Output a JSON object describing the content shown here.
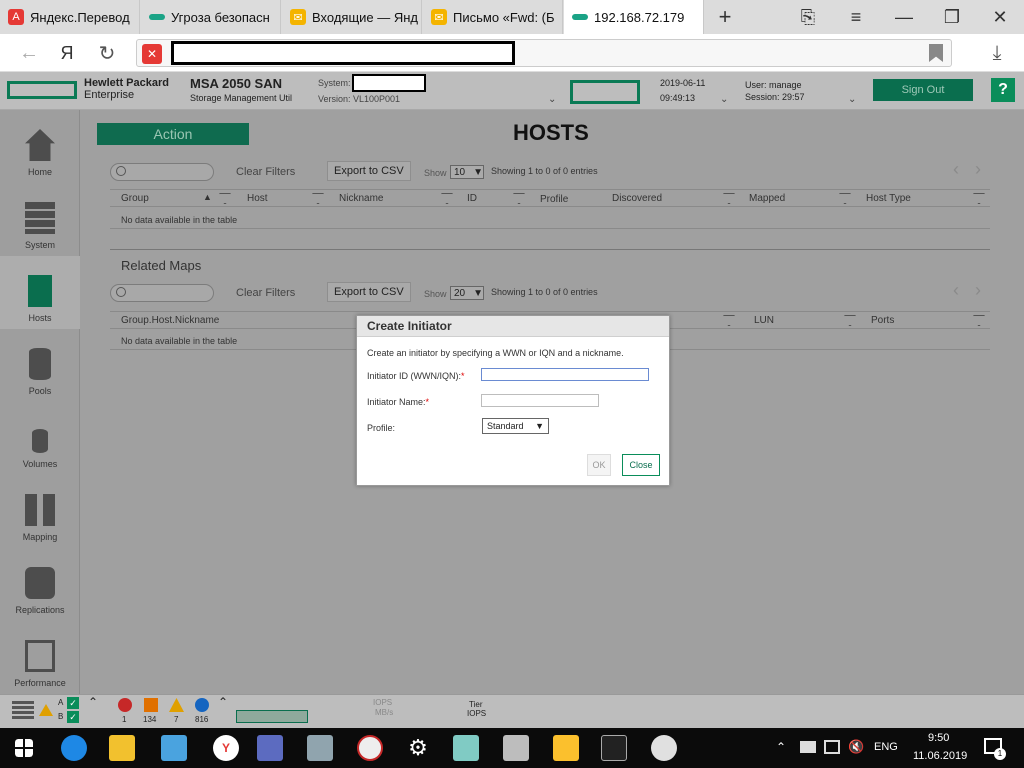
{
  "browser": {
    "tabs": [
      {
        "title": "Яндекс.Перевод",
        "icon": "yandex-translate-icon",
        "color": "#e53935"
      },
      {
        "title": "Угроза безопасн",
        "icon": "security-threat-icon",
        "color": "#1aa386"
      },
      {
        "title": "Входящие — Янд",
        "icon": "mail-icon",
        "color": "#f4b400"
      },
      {
        "title": "Письмо «Fwd: (Б",
        "icon": "mail-icon",
        "color": "#f4b400"
      },
      {
        "title": "192.168.72.179",
        "icon": "hpe-icon",
        "color": "#1aa386"
      }
    ],
    "new_tab_label": "+",
    "yandex_label": "Я"
  },
  "app": {
    "brand_line1": "Hewlett Packard",
    "brand_line2": "Enterprise",
    "product": "MSA 2050 SAN",
    "subtitle": "Storage Management Util",
    "system_label": "System:",
    "version_label": "Version: VL100P001",
    "date": "2019-06-11",
    "time": "09:49:13",
    "user_label": "User: manage",
    "session_label": "Session: 29:57",
    "signout_label": "Sign Out",
    "help_label": "?"
  },
  "sidebar": {
    "items": [
      {
        "label": "Home",
        "icon": "home-icon"
      },
      {
        "label": "System",
        "icon": "system-icon"
      },
      {
        "label": "Hosts",
        "icon": "hosts-icon"
      },
      {
        "label": "Pools",
        "icon": "pools-icon"
      },
      {
        "label": "Volumes",
        "icon": "volumes-icon"
      },
      {
        "label": "Mapping",
        "icon": "mapping-icon"
      },
      {
        "label": "Replications",
        "icon": "replications-icon"
      },
      {
        "label": "Performance",
        "icon": "performance-icon"
      }
    ]
  },
  "main": {
    "action_label": "Action",
    "title": "HOSTS",
    "hosts_table": {
      "clear_filters": "Clear Filters",
      "export_csv": "Export to CSV",
      "show_label": "Show",
      "show_value": "10",
      "info": "Showing 1 to 0 of 0 entries",
      "columns": [
        "Group",
        "Host",
        "Nickname",
        "ID",
        "Profile",
        "Discovered",
        "Mapped",
        "Host Type"
      ],
      "empty": "No data available in the table"
    },
    "related_maps": {
      "title": "Related Maps",
      "clear_filters": "Clear Filters",
      "export_csv": "Export to CSV",
      "show_label": "Show",
      "show_value": "20",
      "info": "Showing 1 to 0 of 0 entries",
      "columns": [
        "Group.Host.Nickname",
        "LUN",
        "Ports"
      ],
      "empty": "No data available in the table"
    }
  },
  "modal": {
    "title": "Create Initiator",
    "description": "Create an initiator by specifying a WWN or IQN and a nickname.",
    "initiator_id_label": "Initiator ID (WWN/IQN):",
    "initiator_name_label": "Initiator Name:",
    "required_mark": "*",
    "initiator_id_value": "",
    "initiator_name_value": "",
    "profile_label": "Profile:",
    "profile_value": "Standard",
    "ok_label": "OK",
    "close_label": "Close"
  },
  "statusbar": {
    "a_label": "A",
    "b_label": "B",
    "count_errors": "1",
    "count_critical": "134",
    "count_warnings": "7",
    "count_info": "816",
    "iops_label": "IOPS",
    "mbs_label": "MB/s",
    "tier_label": "Tier",
    "tier_iops_label": "IOPS"
  },
  "taskbar": {
    "lang": "ENG",
    "time": "9:50",
    "date": "11.06.2019",
    "notif_count": "1"
  }
}
